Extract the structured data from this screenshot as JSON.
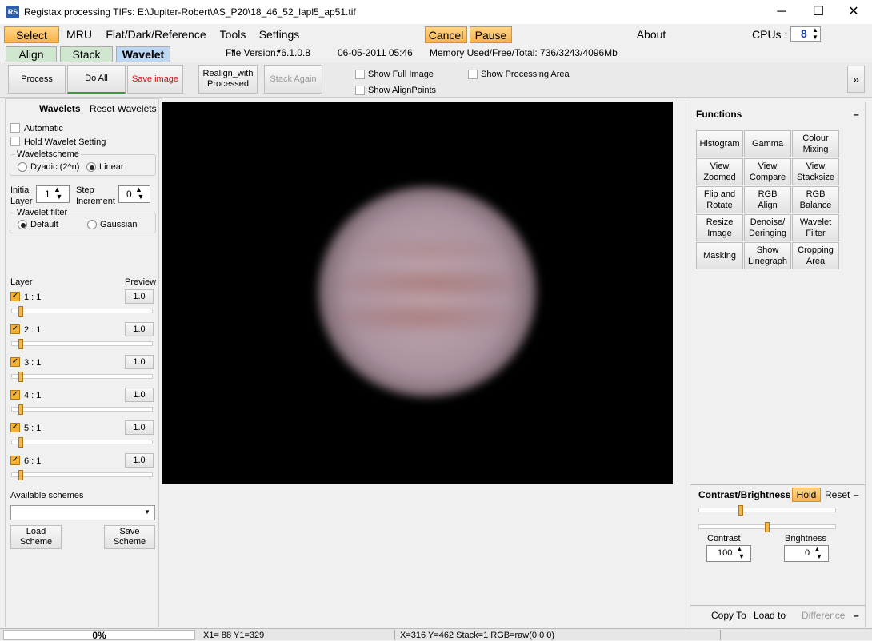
{
  "window": {
    "title": "Registax processing TIFs: E:\\Jupiter-Robert\\AS_P20\\18_46_52_lapl5_ap51.tif",
    "minimize": "─",
    "maximize": "☐",
    "close": "✕",
    "icon": "RS"
  },
  "menu": {
    "select": "Select",
    "mru": "MRU",
    "flat": "Flat/Dark/Reference",
    "tools": "Tools",
    "settings": "Settings",
    "cancel": "Cancel",
    "pause": "Pause",
    "about": "About",
    "cpus_label": "CPUs :",
    "cpus_value": "8"
  },
  "tabs": {
    "align": "Align",
    "stack": "Stack",
    "wavelet": "Wavelet"
  },
  "info": {
    "file_version": "File Version: 6.1.0.8",
    "date": "06-05-2011 05:46",
    "memory": "Memory Used/Free/Total: 736/3243/4096Mb"
  },
  "toolbar": {
    "process": "Process",
    "do_all": "Do All",
    "save_image": "Save image",
    "realign_1": "Realign_with",
    "realign_2": "Processed",
    "stack_again": "Stack Again",
    "show_full_image": "Show Full Image",
    "show_alignpoints": "Show AlignPoints",
    "show_processing_area": "Show Processing Area",
    "expand": "»"
  },
  "left": {
    "wavelets": "Wavelets",
    "reset_wavelets": "Reset Wavelets",
    "automatic": "Automatic",
    "hold": "Hold Wavelet Setting",
    "scheme_title": "Waveletscheme",
    "dyadic": "Dyadic (2^n)",
    "linear": "Linear",
    "initial_1": "Initial",
    "initial_2": "Layer",
    "initial_value": "1",
    "step_1": "Step",
    "step_2": "Increment",
    "step_value": "0",
    "filter_title": "Wavelet filter",
    "default": "Default",
    "gaussian": "Gaussian",
    "layer_header": "Layer",
    "preview_header": "Preview",
    "layers": [
      {
        "label": "1 : 1",
        "preview": "1.0",
        "level": 0.05
      },
      {
        "label": "2 : 1",
        "preview": "1.0",
        "level": 0.05
      },
      {
        "label": "3 : 1",
        "preview": "1.0",
        "level": 0.05
      },
      {
        "label": "4 : 1",
        "preview": "1.0",
        "level": 0.05
      },
      {
        "label": "5 : 1",
        "preview": "1.0",
        "level": 0.05
      },
      {
        "label": "6 : 1",
        "preview": "1.0",
        "level": 0.05
      }
    ],
    "check_mark": "✓",
    "available_schemes": "Available schemes",
    "scheme_select": "",
    "load_1": "Load",
    "load_2": "Scheme",
    "save_1": "Save",
    "save_2": "Scheme"
  },
  "right": {
    "functions": "Functions",
    "collapse": "–",
    "buttons": [
      [
        "Histogram"
      ],
      [
        "Gamma"
      ],
      [
        "Colour",
        "Mixing"
      ],
      [
        "View",
        "Zoomed"
      ],
      [
        "View",
        "Compare"
      ],
      [
        "View",
        "Stacksize"
      ],
      [
        "Flip and",
        "Rotate"
      ],
      [
        "RGB",
        "Align"
      ],
      [
        "RGB",
        "Balance"
      ],
      [
        "Resize",
        "Image"
      ],
      [
        "Denoise/",
        "Deringing"
      ],
      [
        "Wavelet",
        "Filter"
      ],
      [
        "Masking"
      ],
      [
        "Show",
        "Linegraph"
      ],
      [
        "Cropping",
        "Area"
      ]
    ],
    "contrast_title": "Contrast/Brightness",
    "hold": "Hold",
    "reset": "Reset",
    "contrast": "Contrast",
    "contrast_value": "100",
    "brightness": "Brightness",
    "brightness_value": "0",
    "contrast_level": 0.3,
    "brightness_level": 0.5,
    "copy_to": "Copy To",
    "load_to": "Load to",
    "difference": "Difference"
  },
  "status": {
    "progress": "0%",
    "coords1": "X1= 88 Y1=329",
    "coords2": "X=316 Y=462 Stack=1 RGB=raw(0 0 0)"
  }
}
